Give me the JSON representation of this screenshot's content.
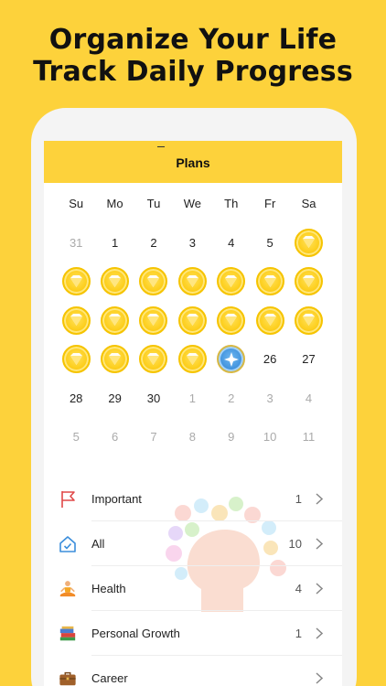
{
  "headline": {
    "line1": "Organize Your Life",
    "line2": "Track Daily Progress"
  },
  "navbar": {
    "title": "Plans"
  },
  "calendar": {
    "weekdays": [
      "Su",
      "Mo",
      "Tu",
      "We",
      "Th",
      "Fr",
      "Sa"
    ],
    "weeks": [
      [
        {
          "t": "31",
          "k": "muted"
        },
        {
          "t": "1",
          "k": "day"
        },
        {
          "t": "2",
          "k": "day"
        },
        {
          "t": "3",
          "k": "day"
        },
        {
          "t": "4",
          "k": "day"
        },
        {
          "t": "5",
          "k": "day"
        },
        {
          "t": "",
          "k": "coin"
        }
      ],
      [
        {
          "t": "",
          "k": "coin"
        },
        {
          "t": "",
          "k": "coin"
        },
        {
          "t": "",
          "k": "coin"
        },
        {
          "t": "",
          "k": "coin"
        },
        {
          "t": "",
          "k": "coin"
        },
        {
          "t": "",
          "k": "coin"
        },
        {
          "t": "",
          "k": "coin"
        }
      ],
      [
        {
          "t": "",
          "k": "coin"
        },
        {
          "t": "",
          "k": "coin"
        },
        {
          "t": "",
          "k": "coin"
        },
        {
          "t": "",
          "k": "coin"
        },
        {
          "t": "",
          "k": "coin"
        },
        {
          "t": "",
          "k": "coin"
        },
        {
          "t": "",
          "k": "coin"
        }
      ],
      [
        {
          "t": "",
          "k": "coin"
        },
        {
          "t": "",
          "k": "coin"
        },
        {
          "t": "",
          "k": "coin"
        },
        {
          "t": "",
          "k": "coin"
        },
        {
          "t": "",
          "k": "star"
        },
        {
          "t": "26",
          "k": "day"
        },
        {
          "t": "27",
          "k": "day"
        }
      ],
      [
        {
          "t": "28",
          "k": "day"
        },
        {
          "t": "29",
          "k": "day"
        },
        {
          "t": "30",
          "k": "day"
        },
        {
          "t": "1",
          "k": "muted"
        },
        {
          "t": "2",
          "k": "muted"
        },
        {
          "t": "3",
          "k": "muted"
        },
        {
          "t": "4",
          "k": "muted"
        }
      ],
      [
        {
          "t": "5",
          "k": "muted"
        },
        {
          "t": "6",
          "k": "muted"
        },
        {
          "t": "7",
          "k": "muted"
        },
        {
          "t": "8",
          "k": "muted"
        },
        {
          "t": "9",
          "k": "muted"
        },
        {
          "t": "10",
          "k": "muted"
        },
        {
          "t": "11",
          "k": "muted"
        }
      ]
    ]
  },
  "lists": [
    {
      "label": "Important",
      "count": "1",
      "icon": "flag-icon"
    },
    {
      "label": "All",
      "count": "10",
      "icon": "home-check-icon"
    },
    {
      "label": "Health",
      "count": "4",
      "icon": "meditation-icon"
    },
    {
      "label": "Personal Growth",
      "count": "1",
      "icon": "books-icon"
    },
    {
      "label": "Career",
      "count": "",
      "icon": "briefcase-icon"
    }
  ],
  "colors": {
    "brand_yellow": "#FDD23B",
    "coin_gold": "#FDCF1E",
    "star_blue": "#3B8EDB"
  }
}
